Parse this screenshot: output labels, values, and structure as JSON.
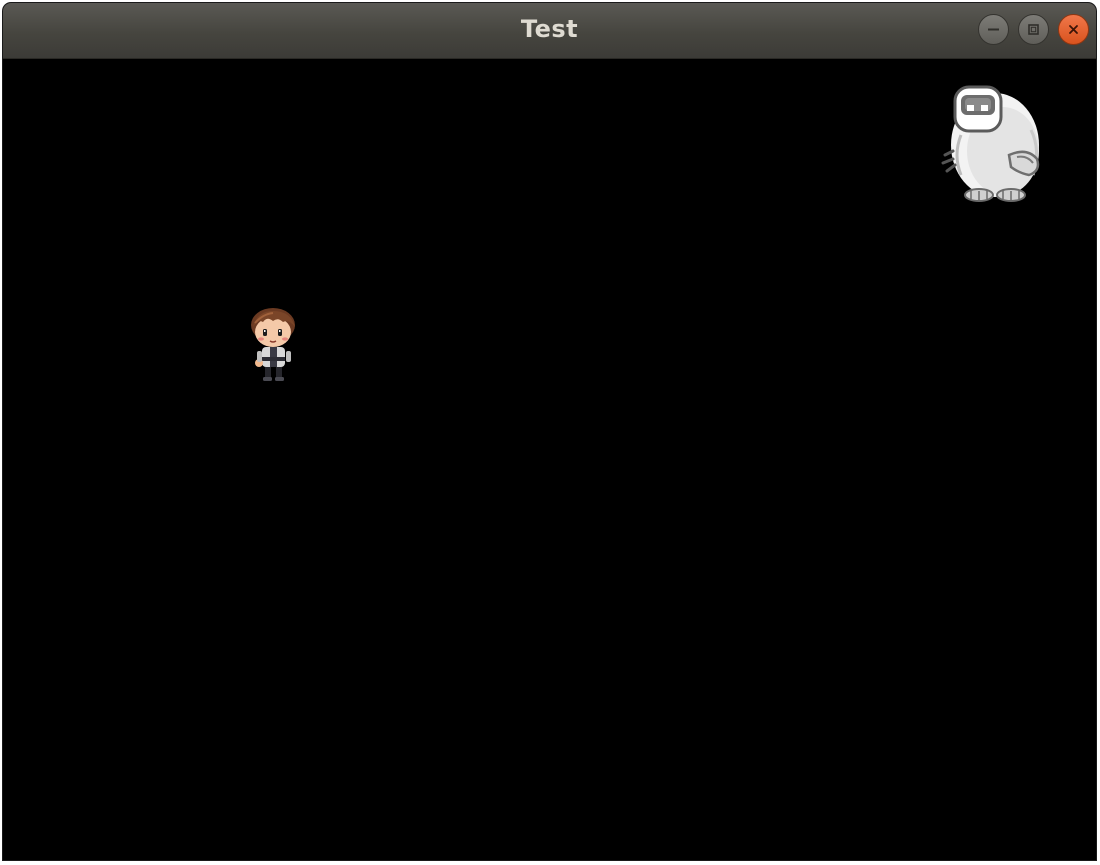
{
  "window": {
    "title": "Test",
    "controls": {
      "minimize_icon": "minimize-icon",
      "maximize_icon": "maximize-icon",
      "close_icon": "close-icon"
    },
    "colors": {
      "titlebar": "#46453f",
      "title_text": "#dfdbd2",
      "close_button": "#e95420",
      "background": "#000000"
    }
  },
  "game": {
    "sprites": [
      {
        "name": "player",
        "icon": "boy-character-icon"
      },
      {
        "name": "enemy",
        "icon": "yeti-monster-icon"
      }
    ]
  }
}
